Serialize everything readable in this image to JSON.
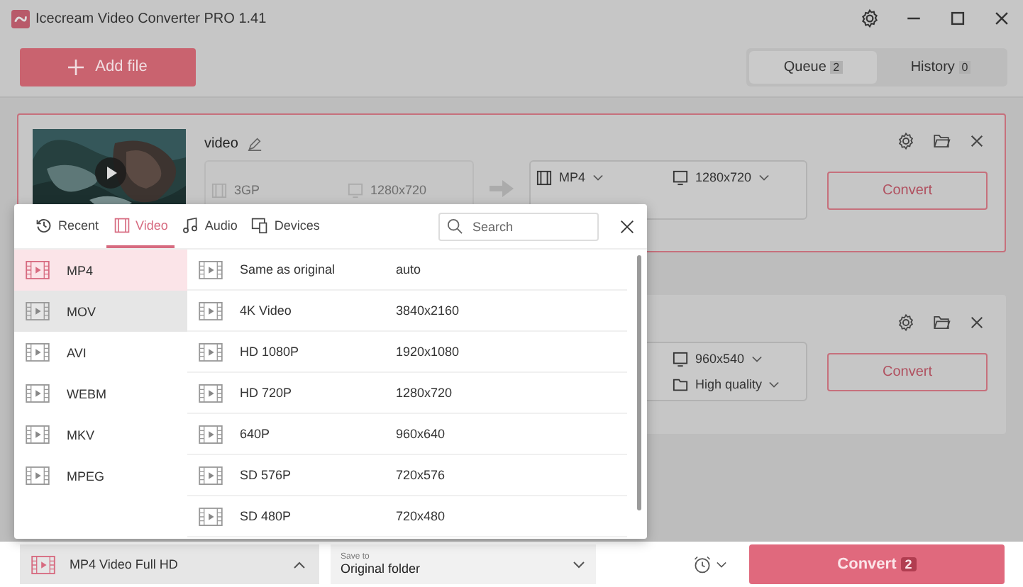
{
  "window": {
    "title": "Icecream Video Converter PRO 1.41"
  },
  "toolbar": {
    "add_button": "Add file",
    "tabs": [
      {
        "label": "Queue",
        "count": "2",
        "selected": true
      },
      {
        "label": "History",
        "count": "0",
        "selected": false
      }
    ]
  },
  "files": [
    {
      "name": "video",
      "highlighted": true,
      "source": {
        "format": "3GP",
        "resolution": "1280x720"
      },
      "target": {
        "format": "MP4",
        "resolution": "1280x720"
      },
      "button": "Convert"
    },
    {
      "highlighted": false,
      "target": {
        "resolution": "960x540",
        "quality": "High quality"
      },
      "button": "Convert"
    }
  ],
  "format_popup": {
    "tabs": [
      {
        "kind": "recent",
        "label": "Recent",
        "selected": false
      },
      {
        "kind": "video",
        "label": "Video",
        "selected": true
      },
      {
        "kind": "audio",
        "label": "Audio",
        "selected": false
      },
      {
        "kind": "devices",
        "label": "Devices",
        "selected": false
      }
    ],
    "search": {
      "placeholder": "Search"
    },
    "formats": [
      {
        "label": "MP4",
        "selected": true,
        "hovered": false
      },
      {
        "label": "MOV",
        "selected": false,
        "hovered": true
      },
      {
        "label": "AVI",
        "selected": false,
        "hovered": false
      },
      {
        "label": "WEBM",
        "selected": false,
        "hovered": false
      },
      {
        "label": "MKV",
        "selected": false,
        "hovered": false
      },
      {
        "label": "MPEG",
        "selected": false,
        "hovered": false
      }
    ],
    "presets": [
      {
        "name": "Same as original",
        "resolution": "auto"
      },
      {
        "name": "4K Video",
        "resolution": "3840x2160"
      },
      {
        "name": "HD 1080P",
        "resolution": "1920x1080"
      },
      {
        "name": "HD 720P",
        "resolution": "1280x720"
      },
      {
        "name": "640P",
        "resolution": "960x640"
      },
      {
        "name": "SD 576P",
        "resolution": "720x576"
      },
      {
        "name": "SD 480P",
        "resolution": "720x480"
      }
    ]
  },
  "bottom_bar": {
    "format": "MP4 Video Full HD",
    "save_to": {
      "label": "Save to",
      "value": "Original folder"
    },
    "convert_button": "Convert",
    "convert_count": "2"
  }
}
